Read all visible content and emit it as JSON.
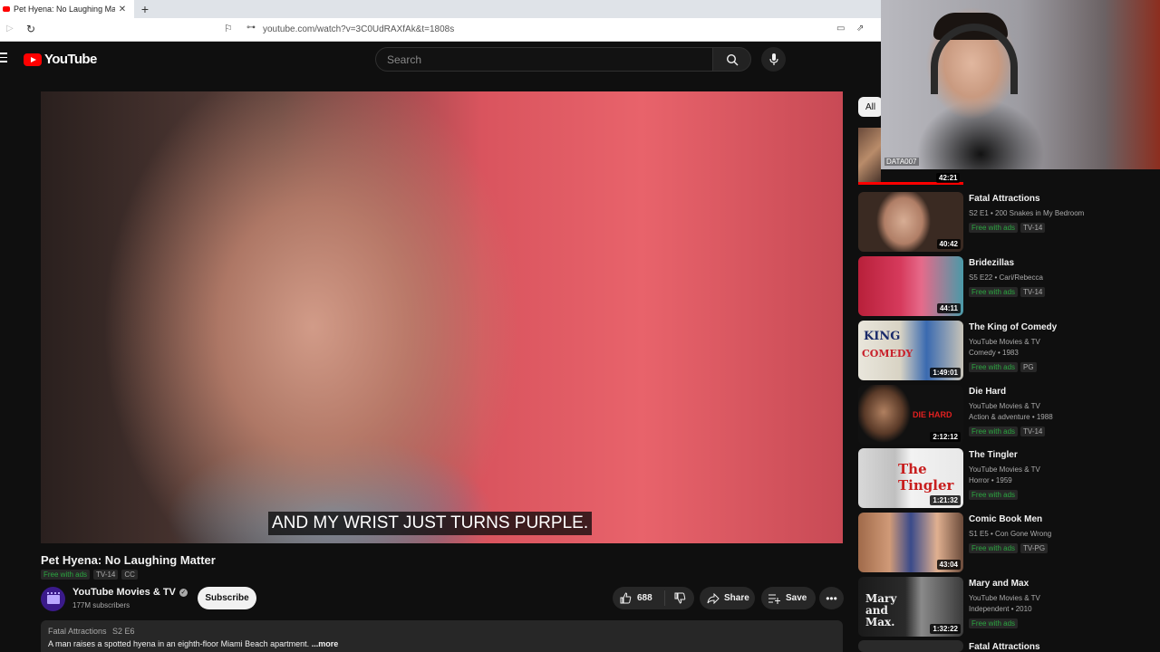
{
  "browser": {
    "tab_title": "Pet Hyena: No Laughing Matter",
    "url": "youtube.com/watch?v=3C0UdRAXfAk&t=1808s"
  },
  "header": {
    "logo_text": "YouTube",
    "search_placeholder": "Search"
  },
  "video": {
    "subtitle": "AND MY WRIST JUST TURNS PURPLE.",
    "title": "Pet Hyena: No Laughing Matter",
    "badges": [
      "Free with ads",
      "TV-14",
      "CC"
    ],
    "channel": "YouTube Movies & TV",
    "subscribers": "177M subscribers",
    "subscribe_label": "Subscribe",
    "likes": "688",
    "share_label": "Share",
    "save_label": "Save",
    "description_show": "Fatal Attractions",
    "description_episode": "S2 E6",
    "description_text": "A man raises a spotted hyena in an eighth-floor Miami Beach apartment.",
    "description_more": "...more"
  },
  "sidebar": {
    "chip_all": "All",
    "webcam_label": "DATA007",
    "first_duration": "42:21",
    "recommendations": [
      {
        "title": "Fatal Attractions",
        "line1": "S2 E1 • 200 Snakes in My Bedroom",
        "line2": "",
        "badges": [
          "Free with ads",
          "TV-14"
        ],
        "duration": "40:42"
      },
      {
        "title": "Bridezillas",
        "line1": "S5 E22 • Cari/Rebecca",
        "line2": "",
        "badges": [
          "Free with ads",
          "TV-14"
        ],
        "duration": "44:11"
      },
      {
        "title": "The King of Comedy",
        "line1": "YouTube Movies & TV",
        "line2": "Comedy • 1983",
        "badges": [
          "Free with ads",
          "PG"
        ],
        "duration": "1:49:01"
      },
      {
        "title": "Die Hard",
        "line1": "YouTube Movies & TV",
        "line2": "Action & adventure • 1988",
        "badges": [
          "Free with ads",
          "TV-14"
        ],
        "duration": "2:12:12"
      },
      {
        "title": "The Tingler",
        "line1": "YouTube Movies & TV",
        "line2": "Horror • 1959",
        "badges": [
          "Free with ads"
        ],
        "duration": "1:21:32"
      },
      {
        "title": "Comic Book Men",
        "line1": "S1 E5 • Con Gone Wrong",
        "line2": "",
        "badges": [
          "Free with ads",
          "TV-PG"
        ],
        "duration": "43:04"
      },
      {
        "title": "Mary and Max",
        "line1": "YouTube Movies & TV",
        "line2": "Independent • 2010",
        "badges": [
          "Free with ads"
        ],
        "duration": "1:32:22"
      },
      {
        "title": "Fatal Attractions",
        "line1": "",
        "line2": "",
        "badges": [],
        "duration": ""
      }
    ],
    "thumb_texts": {
      "king": "KING",
      "comedy": "COMEDY",
      "diehard": "DIE HARD",
      "tingler": "The Tingler",
      "marymax": "Mary and Max."
    }
  },
  "colors": {
    "youtube_red": "#ff0000",
    "free_green": "#2ba640",
    "background": "#0f0f0f"
  }
}
